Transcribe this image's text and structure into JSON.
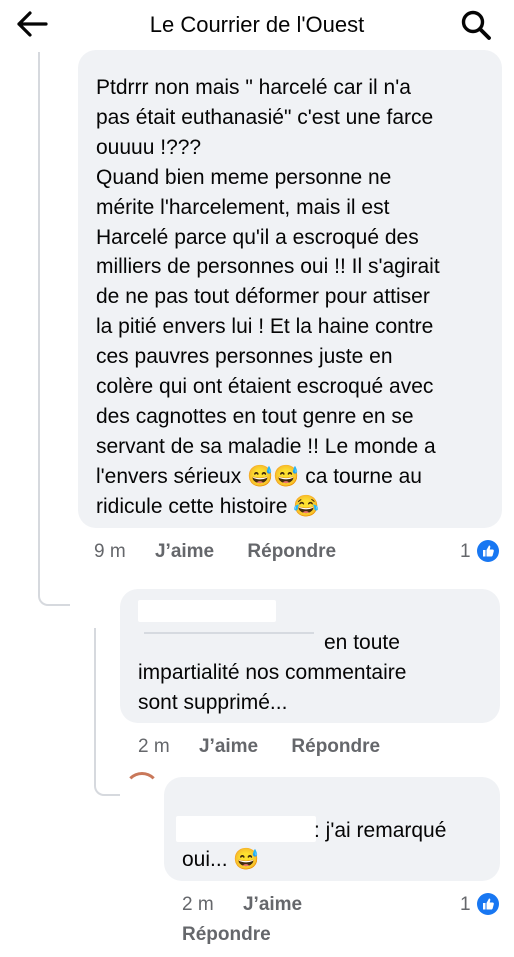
{
  "header": {
    "title": "Le Courrier de l'Ouest"
  },
  "comments": [
    {
      "text": "Ptdrrr non mais \" harcelé car il n'a\npas était euthanasié\" c'est une farce\nouuuu !???\nQuand bien meme personne ne\nmérite l'harcelement, mais il est\nHarcelé parce qu'il a escroqué des\nmilliers de personnes oui !! Il s'agirait\nde ne pas tout déformer pour attiser\nla pitié envers lui ! Et la haine contre\nces pauvres personnes juste en\ncolère qui ont étaient escroqué avec\ndes cagnottes en tout genre en se\nservant de sa maladie !! Le monde a\nl'envers sérieux 😅😅 ca tourne au\nridicule cette histoire 😂",
      "time": "9 m",
      "like_label": "J’aime",
      "reply_label": "Répondre",
      "likes": "1"
    },
    {
      "text_line1": "en toute",
      "text_rest": "impartialité nos commentaire\nsont supprimé...",
      "time": "2 m",
      "like_label": "J’aime",
      "reply_label": "Répondre"
    },
    {
      "text_line1": ": j'ai remarqué",
      "text_rest": "oui... 😅",
      "time": "2 m",
      "like_label": "J’aime",
      "reply_label": "Répondre",
      "likes": "1"
    }
  ],
  "colors": {
    "bubble": "#f0f2f5",
    "meta_text": "#65676b",
    "like_blue": "#1877f2",
    "thread_line": "#d6d9de"
  }
}
